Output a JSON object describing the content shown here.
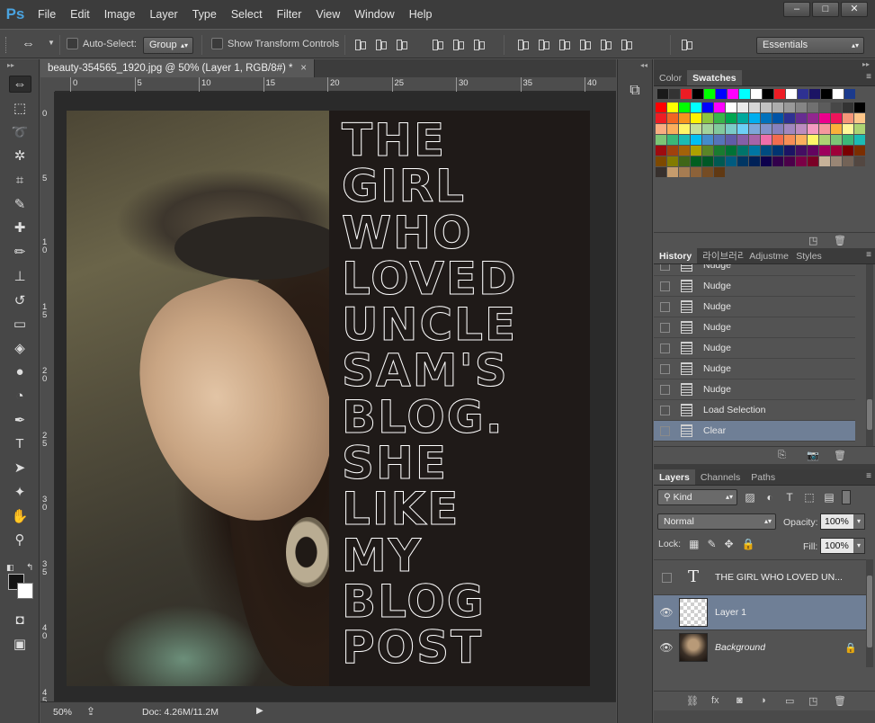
{
  "app": {
    "logo": "Ps",
    "menu": [
      "File",
      "Edit",
      "Image",
      "Layer",
      "Type",
      "Select",
      "Filter",
      "View",
      "Window",
      "Help"
    ],
    "window_controls": [
      "–",
      "□",
      "✕"
    ]
  },
  "options_bar": {
    "auto_select_label": "Auto-Select:",
    "auto_select_value": "Group",
    "show_transform_label": "Show Transform Controls",
    "workspace": "Essentials"
  },
  "tools": [
    {
      "name": "move-tool",
      "glyph": "⇔",
      "active": true
    },
    {
      "name": "marquee-tool",
      "glyph": "⬚"
    },
    {
      "name": "lasso-tool",
      "glyph": "➰"
    },
    {
      "name": "magic-wand-tool",
      "glyph": "✲"
    },
    {
      "name": "crop-tool",
      "glyph": "⌗"
    },
    {
      "name": "eyedropper-tool",
      "glyph": "✎"
    },
    {
      "name": "healing-brush-tool",
      "glyph": "✚"
    },
    {
      "name": "brush-tool",
      "glyph": "✏"
    },
    {
      "name": "clone-stamp-tool",
      "glyph": "⊥"
    },
    {
      "name": "history-brush-tool",
      "glyph": "↺"
    },
    {
      "name": "eraser-tool",
      "glyph": "▭"
    },
    {
      "name": "paint-bucket-tool",
      "glyph": "◈"
    },
    {
      "name": "blur-tool",
      "glyph": "●"
    },
    {
      "name": "dodge-tool",
      "glyph": "◔"
    },
    {
      "name": "pen-tool",
      "glyph": "✒"
    },
    {
      "name": "type-tool",
      "glyph": "T"
    },
    {
      "name": "path-selection-tool",
      "glyph": "➤"
    },
    {
      "name": "shape-tool",
      "glyph": "✦"
    },
    {
      "name": "hand-tool",
      "glyph": "✋"
    },
    {
      "name": "zoom-tool",
      "glyph": "⚲"
    }
  ],
  "document": {
    "tab_title": "beauty-354565_1920.jpg @ 50% (Layer 1, RGB/8#) *",
    "close": "×",
    "ruler_h": [
      "0",
      "5",
      "10",
      "15",
      "20",
      "25",
      "30",
      "35",
      "40"
    ],
    "ruler_v": [
      "0",
      "5",
      "1\n0",
      "1\n5",
      "2\n0",
      "2\n5",
      "3\n0",
      "3\n5",
      "4\n0",
      "4\n5"
    ],
    "selection_lines": [
      "THE",
      "GIRL",
      "WHO",
      "LOVED",
      "UNCLE",
      "SAM'S",
      "BLOG.",
      "SHE",
      "LIKE",
      "MY",
      "BLOG",
      "POST"
    ],
    "zoom": "50%",
    "doc_info": "Doc: 4.26M/11.2M"
  },
  "swatches_panel": {
    "tabs": [
      "Color",
      "Swatches"
    ],
    "active_tab": "Swatches",
    "recent": [
      "#1a1a1a",
      "#333333",
      "#ed1c24",
      "#000000",
      "#00ff00",
      "#0000ff",
      "#ff00ff",
      "#00ffff",
      "#ffffff",
      "#000000",
      "#ed1c24",
      "#ffffff",
      "#2e3192",
      "#1b1464",
      "#000000",
      "#ffffff",
      "#1b3a8c"
    ],
    "rows": [
      [
        "#ff0000",
        "#ffff00",
        "#00ff00",
        "#00ffff",
        "#0000ff",
        "#ff00ff",
        "#ffffff",
        "#ebebeb",
        "#d7d7d7",
        "#c2c2c2",
        "#adadad",
        "#999999",
        "#858585",
        "#707070",
        "#5c5c5c",
        "#474747",
        "#333333",
        "#000000"
      ],
      [
        "#ee1d24",
        "#f26522",
        "#f7941d",
        "#fff200",
        "#8dc63f",
        "#39b54a",
        "#00a651",
        "#00a99d",
        "#00aeef",
        "#0072bc",
        "#0054a6",
        "#2e3192",
        "#662d91",
        "#92278f",
        "#ec008c",
        "#ed145b",
        "#f69679",
        "#fdc689"
      ],
      [
        "#f9ad81",
        "#fbaf5d",
        "#fff568",
        "#c4df9b",
        "#a3d39c",
        "#82ca9d",
        "#7accc8",
        "#6dcff6",
        "#7da7d9",
        "#8393ca",
        "#8781bd",
        "#a187be",
        "#bd8cbf",
        "#f49ac1",
        "#f5989d",
        "#fbb03b",
        "#fff799",
        "#acd373"
      ],
      [
        "#7cc576",
        "#3bb878",
        "#1cbbb4",
        "#00bff3",
        "#448ccb",
        "#5674b9",
        "#605ca8",
        "#855fa8",
        "#a864a8",
        "#f06eaa",
        "#f26c4f",
        "#f68e56",
        "#fbaf5d",
        "#fff568",
        "#acd373",
        "#7cc576",
        "#3bb878",
        "#1cbbb4"
      ],
      [
        "#9e0b0f",
        "#a0410d",
        "#a36209",
        "#aba000",
        "#598527",
        "#197b30",
        "#007236",
        "#00746b",
        "#0076a3",
        "#004b80",
        "#003471",
        "#1b1464",
        "#440e62",
        "#630460",
        "#9e005d",
        "#9e0039",
        "#790000",
        "#7b2e00"
      ],
      [
        "#7d4900",
        "#827b00",
        "#406618",
        "#005e20",
        "#005826",
        "#005952",
        "#005b7f",
        "#003663",
        "#002157",
        "#0d004c",
        "#32004b",
        "#4b0049",
        "#7b0046",
        "#7a0026",
        "#c7b299",
        "#998675",
        "#736357",
        "#534741"
      ],
      [
        "#37302d",
        "#c69c6d",
        "#a67c52",
        "#8c6239",
        "#754c24",
        "#603913"
      ]
    ]
  },
  "history_panel": {
    "tabs": [
      "History",
      "라이브러리",
      "Adjustme",
      "Styles"
    ],
    "active_tab": "History",
    "items": [
      {
        "label": "Nudge"
      },
      {
        "label": "Nudge"
      },
      {
        "label": "Nudge"
      },
      {
        "label": "Nudge"
      },
      {
        "label": "Nudge"
      },
      {
        "label": "Nudge"
      },
      {
        "label": "Nudge"
      },
      {
        "label": "Load Selection"
      },
      {
        "label": "Clear",
        "selected": true
      }
    ]
  },
  "layers_panel": {
    "tabs": [
      "Layers",
      "Channels",
      "Paths"
    ],
    "active_tab": "Layers",
    "filter_kind": "Kind",
    "blend_mode": "Normal",
    "opacity_label": "Opacity:",
    "opacity": "100%",
    "lock_label": "Lock:",
    "fill_label": "Fill:",
    "fill": "100%",
    "layers": [
      {
        "name": "THE GIRL WHO LOVED UN...",
        "type": "text",
        "visible": false
      },
      {
        "name": "Layer 1",
        "type": "pixel",
        "visible": true,
        "selected": true
      },
      {
        "name": "Background",
        "type": "image",
        "visible": true,
        "locked": true
      }
    ]
  }
}
